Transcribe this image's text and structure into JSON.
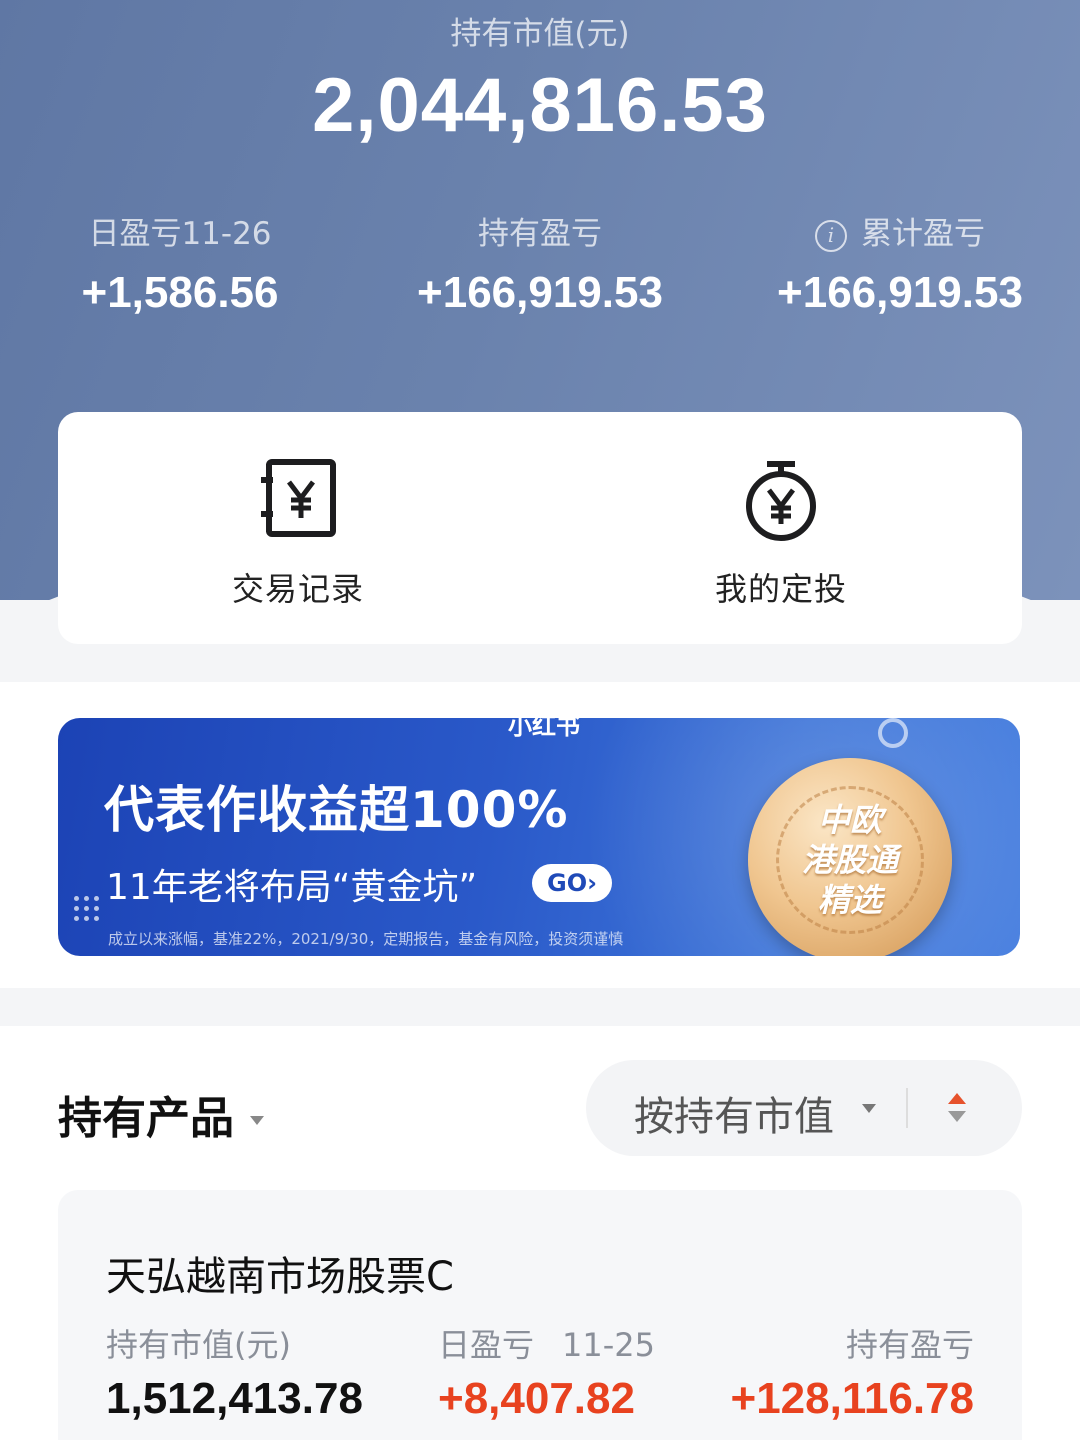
{
  "summary": {
    "total_label": "持有市值(元)",
    "total_value": "2,044,816.53",
    "stats": [
      {
        "label": "日盈亏11-26",
        "value": "+1,586.56"
      },
      {
        "label": "持有盈亏",
        "value": "+166,919.53"
      },
      {
        "label": "累计盈亏",
        "value": "+166,919.53"
      }
    ]
  },
  "quick_actions": [
    {
      "label": "交易记录",
      "icon": "yen-ledger-icon"
    },
    {
      "label": "我的定投",
      "icon": "yen-stopwatch-icon"
    }
  ],
  "banner": {
    "top_text": "小红书",
    "headline": "代表作收益超100%",
    "subline": "11年老将布局“黄金坑”",
    "go_label": "GO›",
    "disclaimer": "成立以来涨幅，基准22%，2021/9/30，定期报告，基金有风险，投资须谨慎",
    "medal_lines": [
      "中欧",
      "港股通",
      "精选"
    ]
  },
  "holdings": {
    "title": "持有产品",
    "sort_label": "按持有市值",
    "funds": [
      {
        "name": "天弘越南市场股票C",
        "market_value_label": "持有市值(元)",
        "market_value": "1,512,413.78",
        "daily_pnl_label": "日盈亏",
        "daily_pnl_date": "11-25",
        "daily_pnl": "+8,407.82",
        "holding_pnl_label": "持有盈亏",
        "holding_pnl": "+128,116.78"
      }
    ]
  },
  "colors": {
    "header_bg": "#6a82ad",
    "banner_bg": "#2a59c9",
    "profit_red": "#e8421f",
    "medal_gold": "#f0c690"
  }
}
